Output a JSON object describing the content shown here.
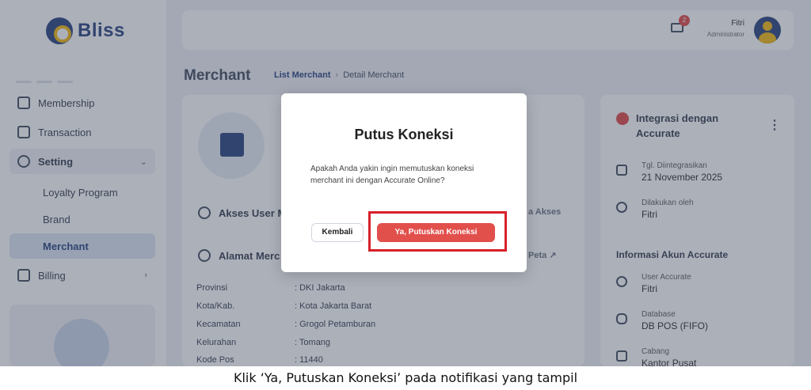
{
  "app": {
    "logo_text": "Bliss"
  },
  "sidebar": {
    "items": [
      {
        "label": "Membership",
        "icon": "membership-icon"
      },
      {
        "label": "Transaction",
        "icon": "receipt-icon"
      },
      {
        "label": "Setting",
        "icon": "gear-icon",
        "expanded": true
      },
      {
        "label": "Billing",
        "icon": "billing-icon"
      }
    ],
    "sub_items": [
      {
        "label": "Loyalty Program"
      },
      {
        "label": "Brand"
      },
      {
        "label": "Merchant",
        "active": true
      }
    ]
  },
  "header": {
    "notification_count": "2",
    "user_name": "Fitri",
    "user_role": "Administrator"
  },
  "page": {
    "title": "Merchant",
    "breadcrumb": [
      "List Merchant",
      "Detail Merchant"
    ],
    "sections": {
      "akses": "Akses User M",
      "akses_right": "a Akses",
      "alamat": "Alamat Merc",
      "alamat_right": "Peta"
    },
    "address": [
      {
        "k": "Provinsi",
        "v": ": DKI Jakarta"
      },
      {
        "k": "Kota/Kab.",
        "v": ": Kota Jakarta Barat"
      },
      {
        "k": "Kecamatan",
        "v": ": Grogol Petamburan"
      },
      {
        "k": "Kelurahan",
        "v": ": Tomang"
      },
      {
        "k": "Kode Pos",
        "v": ": 11440"
      }
    ]
  },
  "integration": {
    "title": "Integrasi dengan Accurate",
    "rows": [
      {
        "label": "Tgl. Diintegrasikan",
        "value": "21 November 2025"
      },
      {
        "label": "Dilakukan oleh",
        "value": "Fitri"
      }
    ],
    "account_heading": "Informasi Akun Accurate",
    "account_rows": [
      {
        "label": "User Accurate",
        "value": "Fitri"
      },
      {
        "label": "Database",
        "value": "DB POS (FIFO)"
      },
      {
        "label": "Cabang",
        "value": "Kantor Pusat"
      }
    ]
  },
  "modal": {
    "title": "Putus Koneksi",
    "message": "Apakah Anda yakin ingin memutuskan koneksi merchant ini dengan Accurate Online?",
    "cancel_label": "Kembali",
    "confirm_label": "Ya, Putuskan Koneksi"
  },
  "caption": "Klik ‘Ya, Putuskan Koneksi’ pada notifikasi yang tampil",
  "colors": {
    "primary": "#1f3b7a",
    "danger": "#e2504c",
    "highlight": "#d8202a"
  }
}
